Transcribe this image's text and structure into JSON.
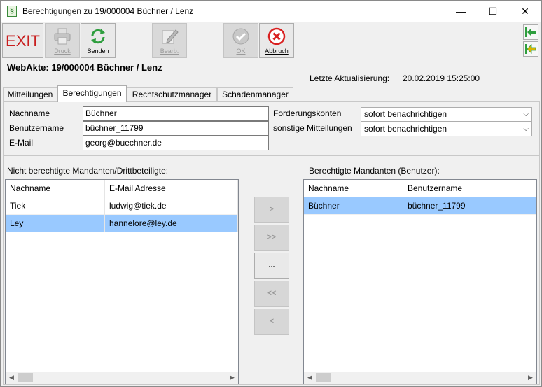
{
  "window": {
    "title": "Berechtigungen zu 19/000004  Büchner / Lenz",
    "app_icon": "§",
    "minimize": "—",
    "maximize": "☐",
    "close": "✕"
  },
  "toolbar": {
    "exit_label": "EXIT",
    "druck_label": "Druck",
    "senden_label": "Senden",
    "bearb_label": "Bearb.",
    "ok_label": "OK",
    "abbruch_label": "Abbruch"
  },
  "header": {
    "webakte": "WebAkte:  19/000004 Büchner / Lenz",
    "update_label": "Letzte Aktualisierung:",
    "update_value": "20.02.2019 15:25:00"
  },
  "tabs": [
    {
      "label": "Mitteilungen"
    },
    {
      "label": "Berechtigungen"
    },
    {
      "label": "Rechtschutzmanager"
    },
    {
      "label": "Schadenmanager"
    }
  ],
  "form": {
    "nachname_label": "Nachname",
    "nachname_value": "Büchner",
    "benutzername_label": "Benutzername",
    "benutzername_value": "büchner_11799",
    "email_label": "E-Mail",
    "email_value": "georg@buechner.de",
    "forderungskonten_label": "Forderungskonten",
    "forderungskonten_value": "sofort benachrichtigen",
    "sonstige_label": "sonstige Mitteilungen",
    "sonstige_value": "sofort benachrichtigen"
  },
  "left_list": {
    "title": "Nicht berechtigte Mandanten/Drittbeteiligte:",
    "columns": [
      "Nachname",
      "E-Mail Adresse"
    ],
    "rows": [
      {
        "name": "Tiek",
        "email": "ludwig@tiek.de"
      },
      {
        "name": "Ley",
        "email": "hannelore@ley.de"
      }
    ]
  },
  "right_list": {
    "title": "Berechtigte Mandanten (Benutzer):",
    "columns": [
      "Nachname",
      "Benutzername"
    ],
    "rows": [
      {
        "name": "Büchner",
        "user": "büchner_11799"
      }
    ]
  },
  "move_buttons": {
    "add": ">",
    "add_all": ">>",
    "more": "...",
    "remove_all": "<<",
    "remove": "<"
  },
  "colors": {
    "selection": "#99c9ff",
    "exit_red": "#c81e1e",
    "send_green": "#2e9e3e",
    "cancel_red": "#d92020"
  }
}
